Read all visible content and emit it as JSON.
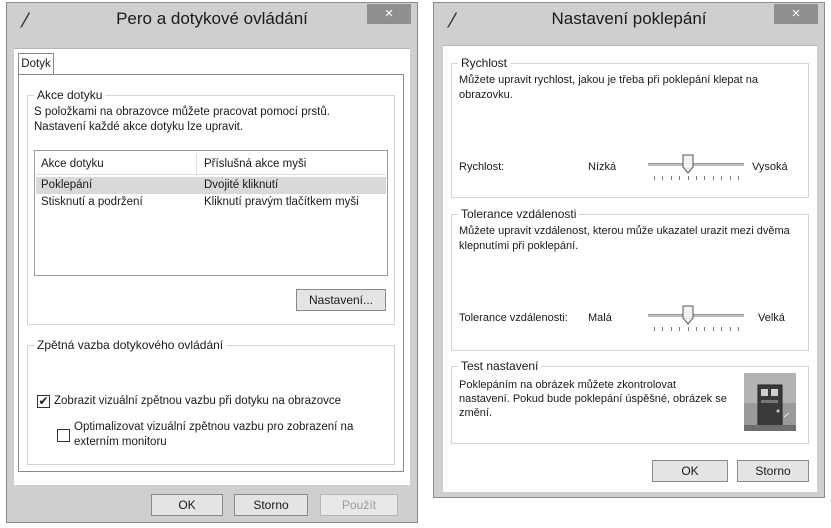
{
  "left_dialog": {
    "title": "Pero a dotykové ovládání",
    "close_label": "×",
    "tab_label": "Dotyk",
    "group_actions": {
      "legend": "Akce dotyku",
      "description": "S položkami na obrazovce můžete pracovat pomocí prstů. Nastavení každé akce dotyku lze upravit.",
      "columns": [
        "Akce dotyku",
        "Příslušná akce myši"
      ],
      "rows": [
        {
          "action": "Poklepání",
          "mouse": "Dvojité kliknutí",
          "selected": true
        },
        {
          "action": "Stisknutí a podržení",
          "mouse": "Kliknutí pravým tlačítkem myši",
          "selected": false
        }
      ],
      "settings_button": "Nastavení..."
    },
    "group_feedback": {
      "legend": "Zpětná vazba dotykového ovládání",
      "checkbox1": {
        "label": "Zobrazit vizuální zpětnou vazbu při dotyku na obrazovce",
        "checked": true
      },
      "checkbox2": {
        "label": "Optimalizovat vizuální zpětnou vazbu pro zobrazení na externím monitoru",
        "checked": false
      }
    },
    "buttons": {
      "ok": "OK",
      "cancel": "Storno",
      "apply": "Použít"
    }
  },
  "right_dialog": {
    "title": "Nastavení poklepání",
    "close_label": "×",
    "speed": {
      "legend": "Rychlost",
      "description": "Můžete upravit rychlost, jakou je třeba při poklepání klepat na obrazovku.",
      "label": "Rychlost:",
      "min_label": "Nízká",
      "max_label": "Vysoká",
      "value_fraction": 0.4
    },
    "tolerance": {
      "legend": "Tolerance vzdálenosti",
      "description": "Můžete upravit vzdálenost, kterou může ukazatel urazit mezi dvěma klepnutími při poklepání.",
      "label": "Tolerance vzdálenosti:",
      "min_label": "Malá",
      "max_label": "Velká",
      "value_fraction": 0.4
    },
    "test": {
      "legend": "Test nastavení",
      "description": "Poklepáním na obrázek můžete zkontrolovat nastavení. Pokud bude poklepání úspěšné, obrázek se změní."
    },
    "buttons": {
      "ok": "OK",
      "cancel": "Storno"
    }
  },
  "colors": {
    "selected_row": "#d9d9d9",
    "window_frame": "#cfcfcf",
    "close_button": "#8f8f8f"
  }
}
